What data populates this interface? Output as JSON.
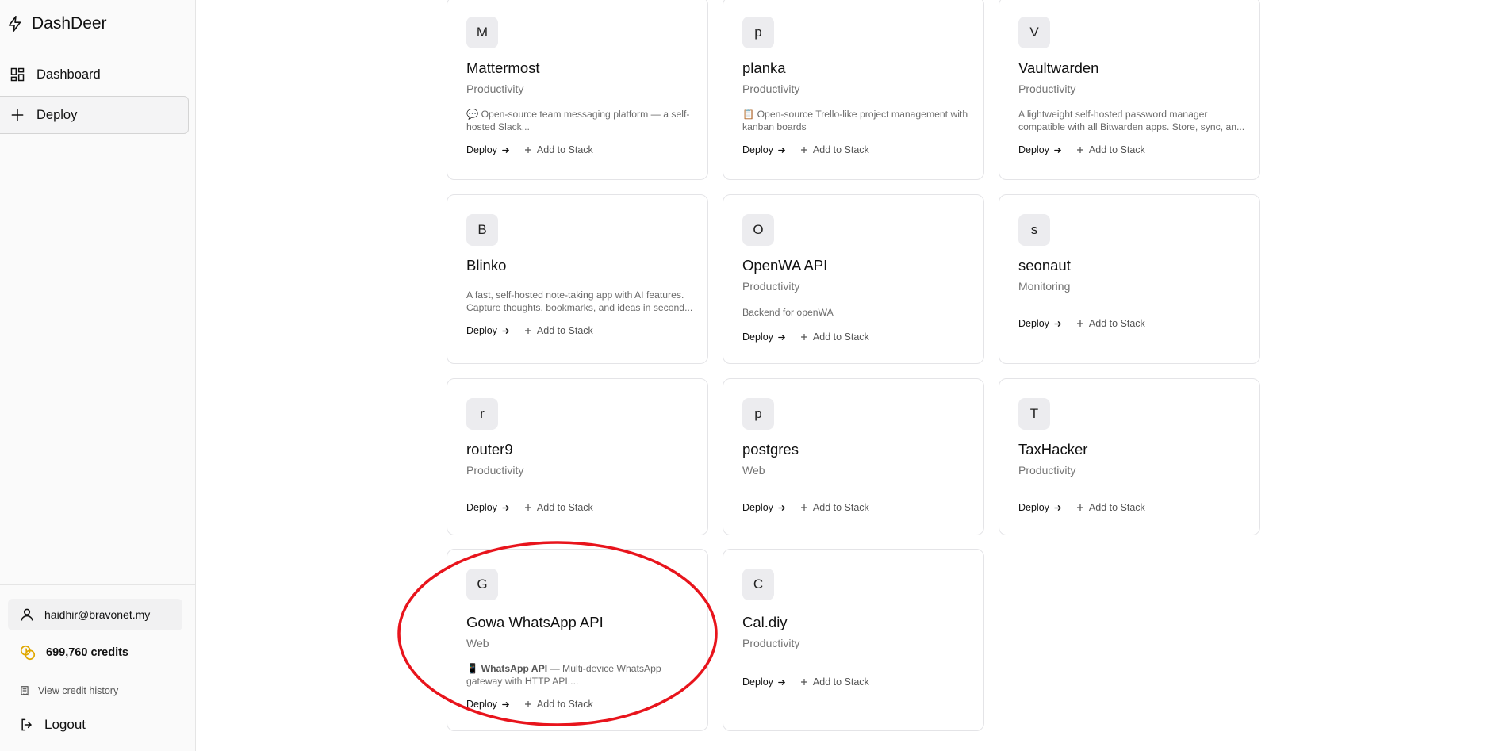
{
  "sidebar": {
    "brand": "DashDeer",
    "nav": [
      {
        "label": "Dashboard",
        "icon": "layout-grid-icon",
        "active": false
      },
      {
        "label": "Deploy",
        "icon": "plus-icon",
        "active": true
      }
    ],
    "user_email": "haidhir@bravonet.my",
    "credits": "699,760 credits",
    "credit_history": "View credit history",
    "logout": "Logout"
  },
  "cards": [
    {
      "avatar": "M",
      "title": "Mattermost",
      "category": "Productivity",
      "emoji": "💬",
      "desc": "Open-source team messaging platform — a self-hosted Slack...",
      "deploy": "Deploy",
      "add": "Add to Stack"
    },
    {
      "avatar": "p",
      "title": "planka",
      "category": "Productivity",
      "emoji": "📋",
      "desc": "Open-source Trello-like project management with kanban boards",
      "deploy": "Deploy",
      "add": "Add to Stack"
    },
    {
      "avatar": "V",
      "title": "Vaultwarden",
      "category": "Productivity",
      "emoji": "",
      "desc": "A lightweight self-hosted password manager compatible with all Bitwarden apps. Store, sync, an...",
      "deploy": "Deploy",
      "add": "Add to Stack"
    },
    {
      "avatar": "B",
      "title": "Blinko",
      "category": "",
      "emoji": "",
      "desc": "A fast, self-hosted note-taking app with AI features. Capture thoughts, bookmarks, and ideas in second...",
      "deploy": "Deploy",
      "add": "Add to Stack"
    },
    {
      "avatar": "O",
      "title": "OpenWA API",
      "category": "Productivity",
      "emoji": "",
      "desc": "Backend for openWA",
      "deploy": "Deploy",
      "add": "Add to Stack"
    },
    {
      "avatar": "s",
      "title": "seonaut",
      "category": "Monitoring",
      "emoji": "",
      "desc": "",
      "deploy": "Deploy",
      "add": "Add to Stack"
    },
    {
      "avatar": "r",
      "title": "router9",
      "category": "Productivity",
      "emoji": "",
      "desc": "",
      "deploy": "Deploy",
      "add": "Add to Stack"
    },
    {
      "avatar": "p",
      "title": "postgres",
      "category": "Web",
      "emoji": "",
      "desc": "",
      "deploy": "Deploy",
      "add": "Add to Stack"
    },
    {
      "avatar": "T",
      "title": "TaxHacker",
      "category": "Productivity",
      "emoji": "",
      "desc": "",
      "deploy": "Deploy",
      "add": "Add to Stack"
    },
    {
      "avatar": "G",
      "title": "Gowa WhatsApp API",
      "category": "Web",
      "emoji": "📱",
      "desc_bold": "WhatsApp API",
      "desc": "— Multi-device WhatsApp gateway with HTTP API....",
      "deploy": "Deploy",
      "add": "Add to Stack"
    },
    {
      "avatar": "C",
      "title": "Cal.diy",
      "category": "Productivity",
      "emoji": "",
      "desc": "",
      "deploy": "Deploy",
      "add": "Add to Stack"
    }
  ],
  "annotation_color": "#e8141c"
}
